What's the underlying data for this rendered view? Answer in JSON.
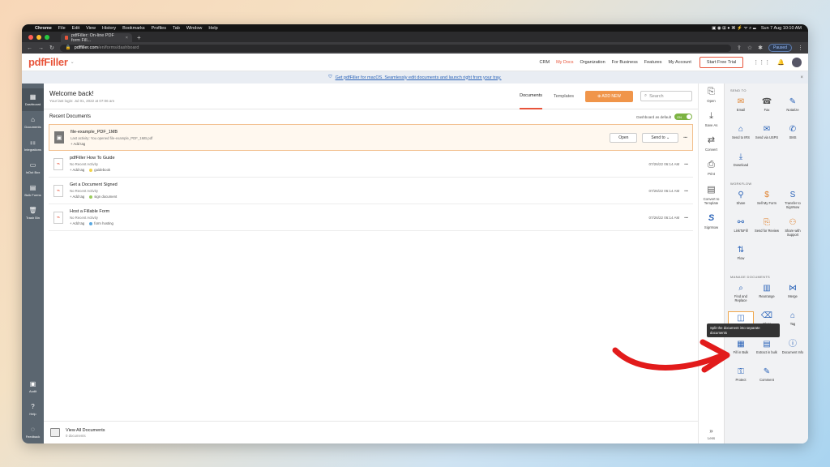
{
  "macos": {
    "app": "Chrome",
    "menu": [
      "File",
      "Edit",
      "View",
      "History",
      "Bookmarks",
      "Profiles",
      "Tab",
      "Window",
      "Help"
    ],
    "clock": "Sun 7 Aug  10:10 AM"
  },
  "browser": {
    "tab_title": "pdfFiller: On-line PDF form Fill...",
    "url_host": "pdffiller.com",
    "url_path": "/en/forms/dashboard",
    "paused": "Paused"
  },
  "topnav": {
    "logo": "pdfFiller",
    "links": [
      "CRM",
      "My Docs",
      "Organization",
      "For Business",
      "Features",
      "My Account"
    ],
    "active": "My Docs",
    "trial": "Start Free Trial"
  },
  "banner": {
    "text": "Get pdfFiller for macOS. Seamlessly edit documents and launch right from your tray."
  },
  "leftnav": {
    "items": [
      {
        "label": "Dashboard",
        "icon": "▦"
      },
      {
        "label": "Documents",
        "icon": "⌂"
      },
      {
        "label": "Integrations",
        "icon": "⚏"
      },
      {
        "label": "InOut Box",
        "icon": "▭"
      },
      {
        "label": "Bulk Forms",
        "icon": "▤"
      },
      {
        "label": "Trash Bin",
        "icon": "🗑"
      }
    ],
    "bottom": [
      {
        "label": "Audit",
        "icon": "▣"
      },
      {
        "label": "Help",
        "icon": "?"
      },
      {
        "label": "Feedback",
        "icon": "◌"
      }
    ]
  },
  "header": {
    "title": "Welcome back!",
    "last_login": "Your last login: Jul 01, 2022 at 07:06 am",
    "tabs": [
      "Documents",
      "Templates"
    ],
    "add_new": "ADD NEW",
    "search_placeholder": "Search"
  },
  "recent": {
    "title": "Recent Documents",
    "dashboard_default": "Dashboard as default",
    "toggle": "ON",
    "docs": [
      {
        "title": "file-example_PDF_1MB",
        "activity": "Last activity: You opened file-example_PDF_1MB.pdf",
        "tag": "",
        "date": "",
        "open": "Open",
        "send": "Send to"
      },
      {
        "title": "pdfFiller How To Guide",
        "activity": "No Recent Activity",
        "tag": "guidebook",
        "tag_color": "#f2d34a",
        "date": "07/26/22 06:14 AM"
      },
      {
        "title": "Get a Document Signed",
        "activity": "No Recent Activity",
        "tag": "sign document",
        "tag_color": "#9acd5a",
        "date": "07/26/22 06:14 AM"
      },
      {
        "title": "Host a Fillable Form",
        "activity": "No Recent Activity",
        "tag": "form hosting",
        "tag_color": "#5aa8e0",
        "date": "07/26/22 06:14 AM"
      }
    ],
    "add_tag": "+ Add tag",
    "view_all": "View All Documents",
    "view_all_count": "0 documents"
  },
  "tools": {
    "items": [
      {
        "label": "Open",
        "icon": "⎘"
      },
      {
        "label": "Save As",
        "icon": "⤓"
      },
      {
        "label": "Convert",
        "icon": "⇄"
      },
      {
        "label": "Print",
        "icon": "⎙"
      },
      {
        "label": "Convert to Template",
        "icon": "▤"
      },
      {
        "label": "SignNow",
        "icon": "S"
      }
    ],
    "less": "Less"
  },
  "rightpanel": {
    "send_to": "SEND TO",
    "send_items": [
      {
        "label": "Email",
        "icon": "✉"
      },
      {
        "label": "Fax",
        "icon": "☎"
      },
      {
        "label": "Notarize",
        "icon": "✎"
      },
      {
        "label": "Send to IRS",
        "icon": "⌂"
      },
      {
        "label": "Send via USPS",
        "icon": "✉"
      },
      {
        "label": "SMS",
        "icon": "✆"
      },
      {
        "label": "Download",
        "icon": "⤓"
      }
    ],
    "workflow": "WORKFLOW",
    "workflow_items": [
      {
        "label": "Share",
        "icon": "⚲"
      },
      {
        "label": "Sell My Form",
        "icon": "$"
      },
      {
        "label": "Transfer to SignNow",
        "icon": "S"
      },
      {
        "label": "LinkToFill",
        "icon": "⚯"
      },
      {
        "label": "Send for Review",
        "icon": "⎘"
      },
      {
        "label": "Share with Support",
        "icon": "⚇"
      },
      {
        "label": "Flow",
        "icon": "⇅"
      }
    ],
    "manage": "MANAGE DOCUMENTS",
    "manage_items": [
      {
        "label": "Find and Replace",
        "icon": "⌕"
      },
      {
        "label": "Rearrange",
        "icon": "▥"
      },
      {
        "label": "Merge",
        "icon": "⋈"
      },
      {
        "label": "Split",
        "icon": "◫"
      },
      {
        "label": "Clear",
        "icon": "⌫"
      },
      {
        "label": "Tag",
        "icon": "⌂"
      },
      {
        "label": "Fill in Bulk",
        "icon": "▦"
      },
      {
        "label": "Extract in bulk",
        "icon": "▤"
      },
      {
        "label": "Document Info",
        "icon": "ⓘ"
      },
      {
        "label": "Protect",
        "icon": "⚿"
      },
      {
        "label": "Comment",
        "icon": "✎"
      }
    ],
    "tooltip": "Split the document into separate documents"
  },
  "colors": {
    "accent": "#e8543a",
    "add_new": "#f0954a",
    "arrow": "#e21b1b"
  }
}
